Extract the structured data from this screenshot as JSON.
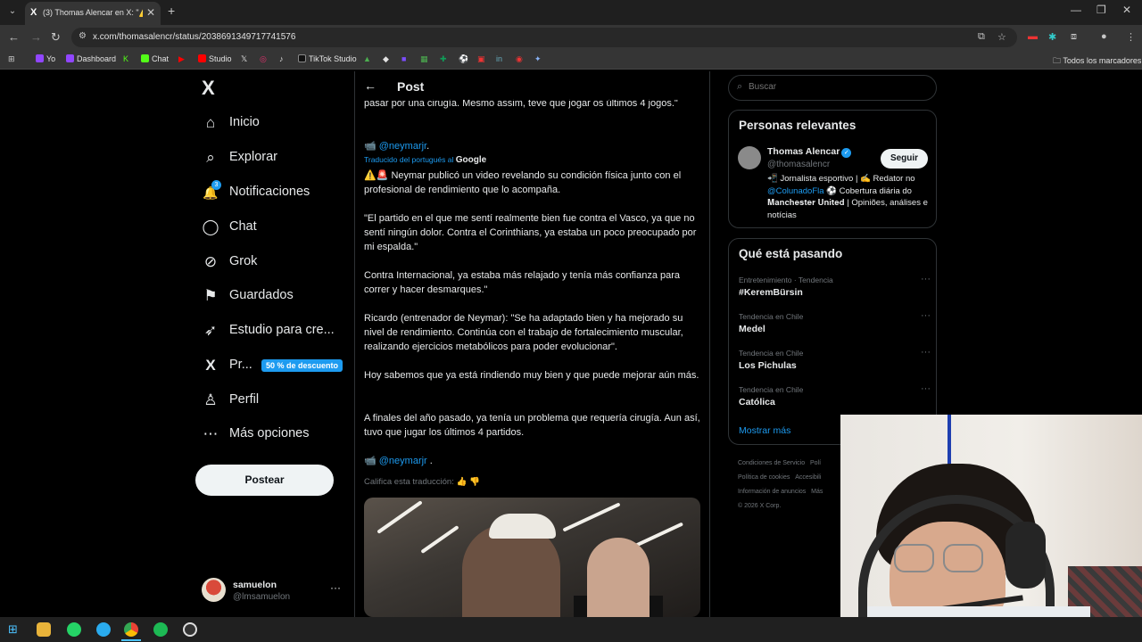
{
  "browser": {
    "tab_title": "(3) Thomas Alencar en X: \"⚠️🚨 ...",
    "tab_favicon": "X",
    "url": "x.com/thomasalencr/status/2038691349717741576",
    "bookmarks": [
      "Yo",
      "Dashboard",
      "Chat",
      "Studio",
      "TikTok Studio"
    ],
    "all_bookmarks": "Todos los marcadores"
  },
  "sidebar": {
    "logo": "X",
    "items": [
      {
        "label": "Inicio",
        "icon": "⌂"
      },
      {
        "label": "Explorar",
        "icon": "⌕"
      },
      {
        "label": "Notificaciones",
        "icon": "🔔",
        "badge": "3"
      },
      {
        "label": "Chat",
        "icon": "◯"
      },
      {
        "label": "Grok",
        "icon": "⊘"
      },
      {
        "label": "Guardados",
        "icon": "⚑"
      },
      {
        "label": "Estudio para cre...",
        "icon": "➶"
      },
      {
        "label": "Pr...",
        "icon": "X",
        "badge": "50 % de descuento"
      },
      {
        "label": "Perfil",
        "icon": "♙"
      },
      {
        "label": "Más opciones",
        "icon": "⋯"
      }
    ],
    "post_button": "Postear",
    "account": {
      "name": "samuelon",
      "handle": "@lmsamuelon",
      "more": "···"
    }
  },
  "post": {
    "back": "←",
    "title": "Post",
    "top_text": "pasar por una cirugía. Mesmo assim, teve que jogar os últimos 4 jogos.\"",
    "mention1_prefix": "📹 ",
    "mention1": "@neymarjr",
    "mention1_suffix": ".",
    "translated_label": "Traducido del portugués al",
    "translated_provider": "Google",
    "paragraphs": [
      "⚠️🚨 Neymar publicó un video revelando su condición física junto con el profesional de rendimiento que lo acompaña.",
      "\"El partido en el que me sentí realmente bien fue contra el Vasco, ya que no sentí ningún dolor. Contra el Corinthians, ya estaba un poco preocupado por mi espalda.\"",
      "Contra Internacional, ya estaba más relajado y tenía más confianza para correr y hacer desmarques.\"",
      "Ricardo (entrenador de Neymar): \"Se ha adaptado bien y ha mejorado su nivel de rendimiento. Continúa con el trabajo de fortalecimiento muscular, realizando ejercicios metabólicos para poder evolucionar\".",
      "Hoy sabemos que ya está rindiendo muy bien y que puede mejorar aún más.",
      "A finales del año pasado, ya tenía un problema que requería cirugía. Aun así, tuvo que jugar los últimos 4 partidos."
    ],
    "mention2_prefix": "📹 ",
    "mention2": "@neymarjr",
    "mention2_suffix": " .",
    "rate_translation": "Califica esta traducción:",
    "thumbs": "👍 👎"
  },
  "right": {
    "search_placeholder": "Buscar",
    "relevant_title": "Personas relevantes",
    "person": {
      "name": "Thomas Alencar",
      "verified": "✓",
      "handle": "@thomasalencr",
      "follow": "Seguir",
      "bio_prefix": "📲 Jornalista esportivo | ✍️ Redator no ",
      "bio_mention": "@ColunadoFla",
      "bio_suffix": " ⚽ Cobertura diária do 𝐌𝐚𝐧𝐜𝐡𝐞𝐬𝐭𝐞𝐫 𝐔𝐧𝐢𝐭𝐞𝐝 | Opiniões, análises e notícias"
    },
    "trending_title": "Qué está pasando",
    "trends": [
      {
        "meta": "Entretenimiento · Tendencia",
        "name": "#KeremBürsin"
      },
      {
        "meta": "Tendencia en Chile",
        "name": "Medel"
      },
      {
        "meta": "Tendencia en Chile",
        "name": "Los Pichulas"
      },
      {
        "meta": "Tendencia en Chile",
        "name": "Católica"
      }
    ],
    "show_more": "Mostrar más",
    "footer": [
      "Condiciones de Servicio",
      "Polí",
      "Política de cookies",
      "Accesibili",
      "Información de anuncios",
      "Más",
      "© 2026 X Corp."
    ]
  },
  "colors": {
    "accent": "#1d9bf0",
    "bg": "#000000",
    "border": "#2f3336"
  }
}
